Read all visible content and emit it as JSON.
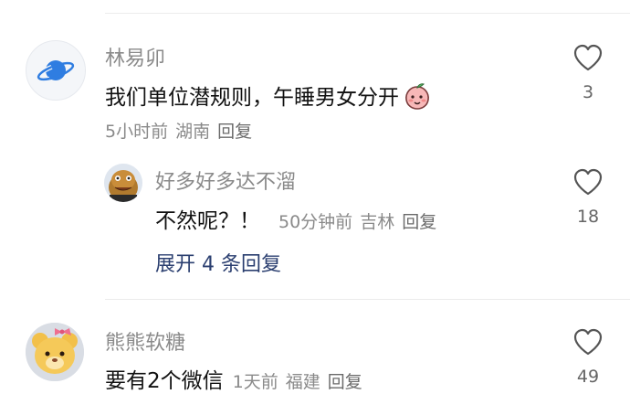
{
  "comments": [
    {
      "username": "林易卯",
      "text": "我们单位潜规则，午睡男女分开",
      "time": "5小时前",
      "location": "湖南",
      "reply_label": "回复",
      "likes": "3",
      "emoji_icon": "peach-blush-emoji-icon",
      "replies": [
        {
          "username": "好多好多达不溜",
          "text": "不然呢？！",
          "time": "50分钟前",
          "location": "吉林",
          "reply_label": "回复",
          "likes": "18"
        }
      ],
      "expand_label": "展开 4 条回复"
    },
    {
      "username": "熊熊软糖",
      "text": "要有2个微信",
      "time": "1天前",
      "location": "福建",
      "reply_label": "回复",
      "likes": "49"
    }
  ],
  "colors": {
    "username": "#8a8a8a",
    "body_text": "#111111",
    "meta_text": "#8a8a8a",
    "expand_link": "#2b3f70",
    "divider": "#ececec"
  }
}
